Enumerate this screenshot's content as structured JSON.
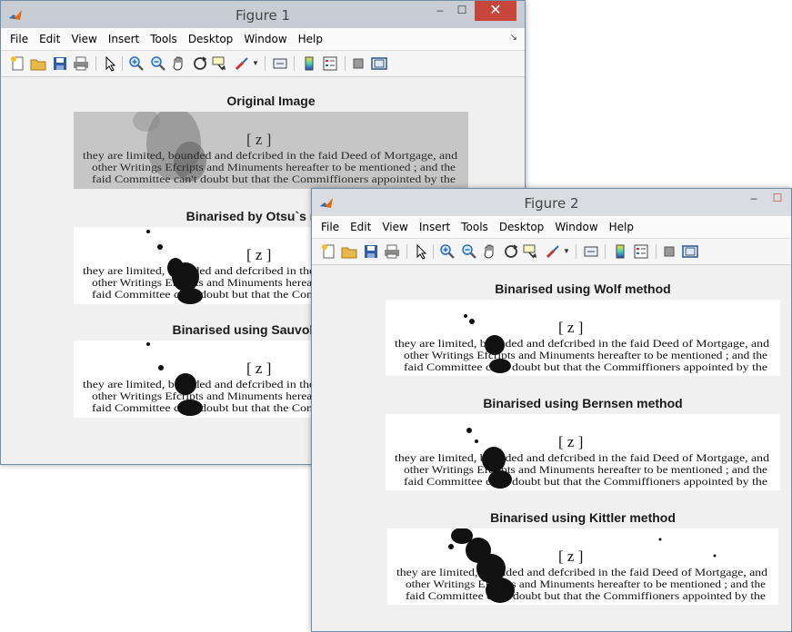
{
  "windows": [
    {
      "title": "Figure 1",
      "controls": {
        "minimize": "–",
        "maximize": "☐",
        "close": "✕"
      },
      "menu": [
        "File",
        "Edit",
        "View",
        "Insert",
        "Tools",
        "Desktop",
        "Window",
        "Help"
      ],
      "axes_titles": [
        "Original Image",
        "Binarised by Otsu`s method",
        "Binarised using Sauvola method"
      ]
    },
    {
      "title": "Figure 2",
      "controls": {
        "minimize": "–",
        "maximize": "☐"
      },
      "menu": [
        "File",
        "Edit",
        "View",
        "Insert",
        "Tools",
        "Desktop",
        "Window",
        "Help"
      ],
      "axes_titles": [
        "Binarised using Wolf method",
        "Binarised using Bernsen method",
        "Binarised using Kittler method"
      ]
    }
  ],
  "document_text": {
    "page_mark": "[ z ]",
    "line1": "they are limited, bounded and defcribed in the faid Deed of Mortgage, and",
    "line2": "other Writings Efcripts and Minuments hereafter to be mentioned ; and the",
    "line3": "faid Committee can't doubt but that the Commiffioners appointed by the"
  },
  "colors": {
    "close_button": "#c7463b",
    "figure_background": "#f0f0f0",
    "ink": "#111111",
    "original_paper": "#c9c9c9"
  },
  "icons": [
    "new-figure-icon",
    "open-file-icon",
    "save-icon",
    "print-icon",
    "pointer-icon",
    "zoom-in-icon",
    "zoom-out-icon",
    "pan-icon",
    "rotate-3d-icon",
    "data-cursor-icon",
    "brush-icon",
    "link-icon",
    "colorbar-icon",
    "legend-icon",
    "hide-plot-tools-icon",
    "show-plot-tools-icon"
  ]
}
